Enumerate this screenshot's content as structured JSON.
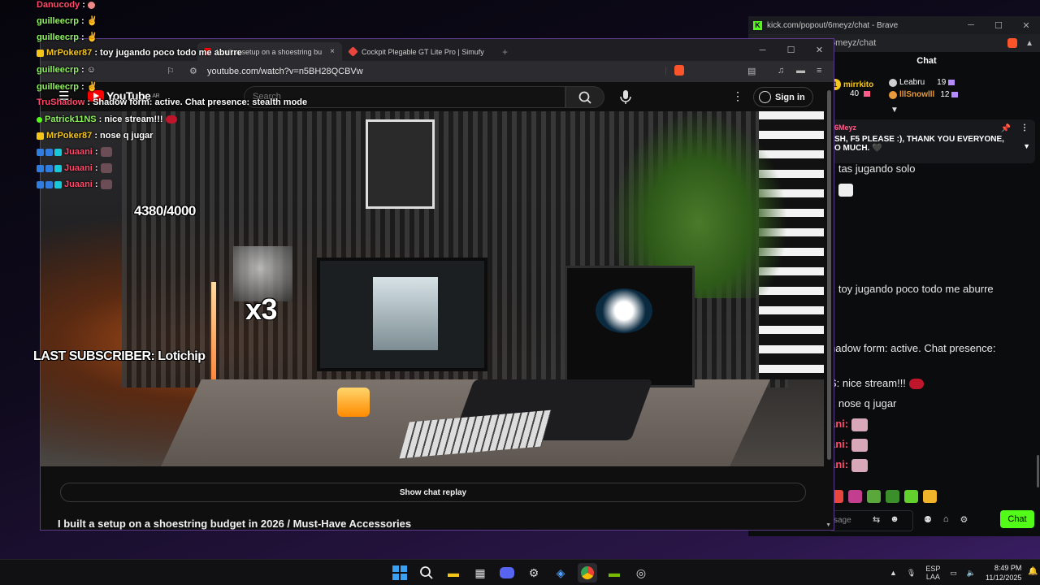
{
  "kick": {
    "window_title": "kick.com/popout/6meyz/chat - Brave",
    "url_fragment": "/6meyz/chat",
    "chat_header": "Chat",
    "top_gifters": [
      {
        "name": "mirrkito",
        "count": "40",
        "color": "#f5c518"
      },
      {
        "name": "Leabru",
        "count": "19",
        "color": "#cfcfcf"
      },
      {
        "name": "lllSnowlll",
        "count": "12",
        "color": "#e89a3c"
      }
    ],
    "pinned": {
      "author": "6Meyz",
      "text_line1": "SH, F5 PLEASE :), THANK YOU EVERYONE,",
      "text_line2": "O MUCH. 🖤"
    },
    "messages": [
      {
        "text": "/: tas jugando solo"
      },
      {
        "text": "/:"
      },
      {
        "text": "/: toy jugando poco todo me aburre"
      },
      {
        "text": "hadow form: active. Chat presence:"
      },
      {
        "text": "S: nice stream!!!"
      },
      {
        "text": "/: nose q jugar"
      },
      {
        "text": "ani:"
      },
      {
        "text": "ani:"
      },
      {
        "text": "ani:"
      }
    ],
    "input_placeholder": "sage",
    "send_label": "Chat",
    "accent": "#53fc18"
  },
  "browser": {
    "tabs": [
      {
        "label": "I built a setup on a shoestring bu",
        "close": "×"
      },
      {
        "label": "Cockpit Plegable GT Lite Pro | Simufy",
        "close": "×"
      }
    ],
    "new_tab": "+",
    "url": "youtube.com/watch?v=n5BH28QCBVw"
  },
  "youtube": {
    "logo_text": "YouTube",
    "region": "AR",
    "search_placeholder": "Search",
    "signin_label": "Sign in",
    "show_chat_replay": "Show chat replay",
    "video_title": "I built a setup on a shoestring budget in 2026 / Must-Have Accessories"
  },
  "overlay": {
    "chat": [
      {
        "name": "Danucody",
        "message": "",
        "color": "#ff4a6b"
      },
      {
        "name": "guilleecrp",
        "message": "",
        "color": "#8ef15f"
      },
      {
        "name": "guilleecrp",
        "message": "",
        "color": "#8ef15f"
      },
      {
        "name": "MrPoker87",
        "message": "toy jugando poco todo me aburre",
        "color": "#f5c518"
      },
      {
        "name": "guilleecrp",
        "message": "",
        "color": "#8ef15f"
      },
      {
        "name": "guilleecrp",
        "message": "",
        "color": "#8ef15f"
      },
      {
        "name": "TruShadow",
        "message": "Shadow form: active. Chat presence: stealth mode",
        "color": "#ff4a6b"
      },
      {
        "name": "Patrick11NS",
        "message": "nice stream!!!",
        "color": "#8ef15f"
      },
      {
        "name": "MrPoker87",
        "message": "nose q jugar",
        "color": "#f5c518"
      },
      {
        "name": "Juaani",
        "message": "",
        "color": "#ff4a6b"
      },
      {
        "name": "Juaani",
        "message": "",
        "color": "#ff4a6b"
      },
      {
        "name": "Juaani",
        "message": "",
        "color": "#ff4a6b"
      }
    ],
    "goal": "4380/4000",
    "multiplier": "x3",
    "last_subscriber": "LAST SUBSCRIBER: Lotichip"
  },
  "taskbar": {
    "lang_line1": "ESP",
    "lang_line2": "LAA",
    "time": "8:49 PM",
    "date": "11/12/2025"
  }
}
